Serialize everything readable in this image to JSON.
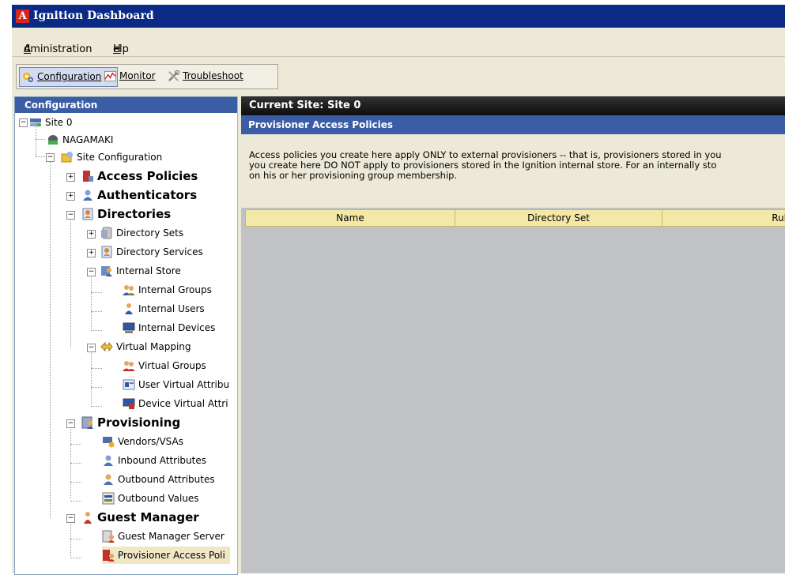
{
  "window": {
    "title": "Ignition Dashboard",
    "logo_letter": "A"
  },
  "menu": {
    "items": [
      "Administration",
      "Help"
    ]
  },
  "toolbar": {
    "tabs": [
      {
        "label": "Configuration",
        "icon": "gear-icon",
        "selected": true
      },
      {
        "label": "Monitor",
        "icon": "chart-icon",
        "selected": false
      },
      {
        "label": "Troubleshoot",
        "icon": "tools-icon",
        "selected": false
      }
    ]
  },
  "left": {
    "header": "Configuration",
    "tree": [
      {
        "label": "Site 0",
        "icon": "server-icon"
      },
      {
        "label": "NAGAMAKI",
        "icon": "server-green-icon"
      },
      {
        "label": "Site Configuration",
        "icon": "config-icon"
      },
      {
        "label": "Access Policies",
        "icon": "policy-icon"
      },
      {
        "label": "Authenticators",
        "icon": "authenticator-icon"
      },
      {
        "label": "Directories",
        "icon": "directory-icon"
      },
      {
        "label": "Directory Sets",
        "icon": "directory-set-icon"
      },
      {
        "label": "Directory Services",
        "icon": "directory-service-icon"
      },
      {
        "label": "Internal Store",
        "icon": "internal-store-icon"
      },
      {
        "label": "Internal Groups",
        "icon": "group-icon"
      },
      {
        "label": "Internal Users",
        "icon": "user-icon"
      },
      {
        "label": "Internal Devices",
        "icon": "device-icon"
      },
      {
        "label": "Virtual Mapping",
        "icon": "mapping-icon"
      },
      {
        "label": "Virtual Groups",
        "icon": "virtual-group-icon"
      },
      {
        "label": "User Virtual Attribu",
        "icon": "user-attr-icon"
      },
      {
        "label": "Device Virtual Attri",
        "icon": "device-attr-icon"
      },
      {
        "label": "Provisioning",
        "icon": "provisioning-icon"
      },
      {
        "label": "Vendors/VSAs",
        "icon": "vendor-icon"
      },
      {
        "label": "Inbound Attributes",
        "icon": "inbound-icon"
      },
      {
        "label": "Outbound Attributes",
        "icon": "outbound-icon"
      },
      {
        "label": "Outbound Values",
        "icon": "values-icon"
      },
      {
        "label": "Guest Manager",
        "icon": "guest-icon"
      },
      {
        "label": "Guest Manager Server",
        "icon": "guest-server-icon"
      },
      {
        "label": "Provisioner Access Poli",
        "icon": "provisioner-policy-icon"
      }
    ]
  },
  "right": {
    "current_site": "Current Site:  Site 0",
    "panel_title": "Provisioner Access Policies",
    "description": [
      "Access policies you create here apply ONLY to external provisioners -- that is, provisioners stored in you",
      "you create here DO NOT apply to provisioners stored in the Ignition internal store. For an internally sto",
      "on his or her provisioning group membership."
    ],
    "columns": [
      "Name",
      "Directory Set",
      "Rule(s)"
    ]
  },
  "colors": {
    "title_bar": "#0a2a86",
    "panel_header": "#3a5da5",
    "grid_header": "#f4e8a7",
    "content_bg": "#c0c2c5"
  }
}
